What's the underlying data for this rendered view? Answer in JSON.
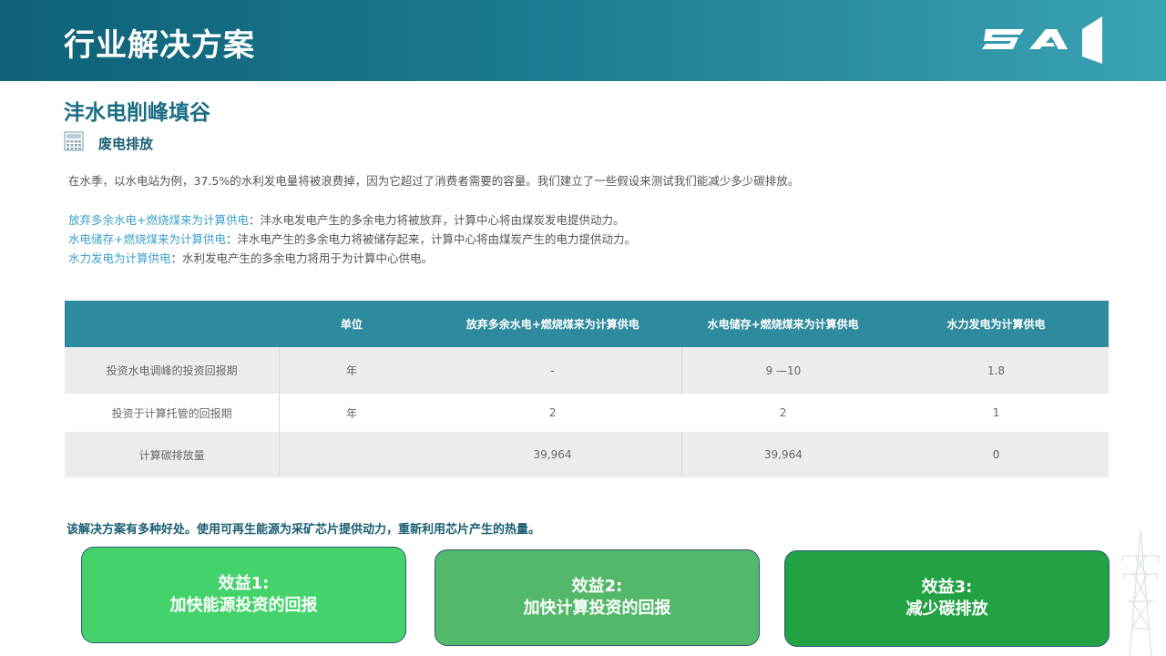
{
  "header": {
    "title": "行业解决方案",
    "logo_text": "SAI"
  },
  "section": {
    "title": "沣水电削峰填谷",
    "subsection_icon": "calculator-icon",
    "subsection_title": "废电排放"
  },
  "intro": "在水季，以水电站为例，37.5%的水利发电量将被浪费掉，因为它超过了消费者需要的容量。我们建立了一些假设来测试我们能减少多少碳排放。",
  "scenarios": [
    {
      "name": "放弃多余水电+燃烧煤来为计算供电",
      "desc": "：沣水电发电产生的多余电力将被放弃，计算中心将由煤炭发电提供动力。"
    },
    {
      "name": "水电储存+燃烧煤来为计算供电",
      "desc": "：沣水电产生的多余电力将被储存起来，计算中心将由煤炭产生的电力提供动力。"
    },
    {
      "name": "水力发电为计算供电",
      "desc": "：水利发电产生的多余电力将用于为计算中心供电。"
    }
  ],
  "table": {
    "headers": [
      "",
      "单位",
      "放弃多余水电+燃烧煤来为计算供电",
      "水电储存+燃烧煤来为计算供电",
      "水力发电为计算供电"
    ],
    "rows": [
      [
        "投资水电调峰的投资回报期",
        "年",
        "-",
        "9 —10",
        "1.8"
      ],
      [
        "投资于计算托管的回报期",
        "年",
        "2",
        "2",
        "1"
      ],
      [
        "计算碳排放量",
        "",
        "39,964",
        "39,964",
        "0"
      ]
    ]
  },
  "benefits": {
    "intro": "该解决方案有多种好处。使用可再生能源为采矿芯片提供动力，重新利用芯片产生的热量。",
    "cards": [
      {
        "title": "效益1:",
        "text": "加快能源投资的回报"
      },
      {
        "title": "效益2:",
        "text": "加快计算投资的回报"
      },
      {
        "title": "效益3:",
        "text": "减少碳排放"
      }
    ]
  },
  "colors": {
    "header_start": "#0f6178",
    "header_end": "#3aa3b3",
    "table_header": "#2e8a9e",
    "highlight": "#3aa0c7",
    "card1": "#43d36a",
    "card2": "#53b869",
    "card3": "#22a243"
  }
}
